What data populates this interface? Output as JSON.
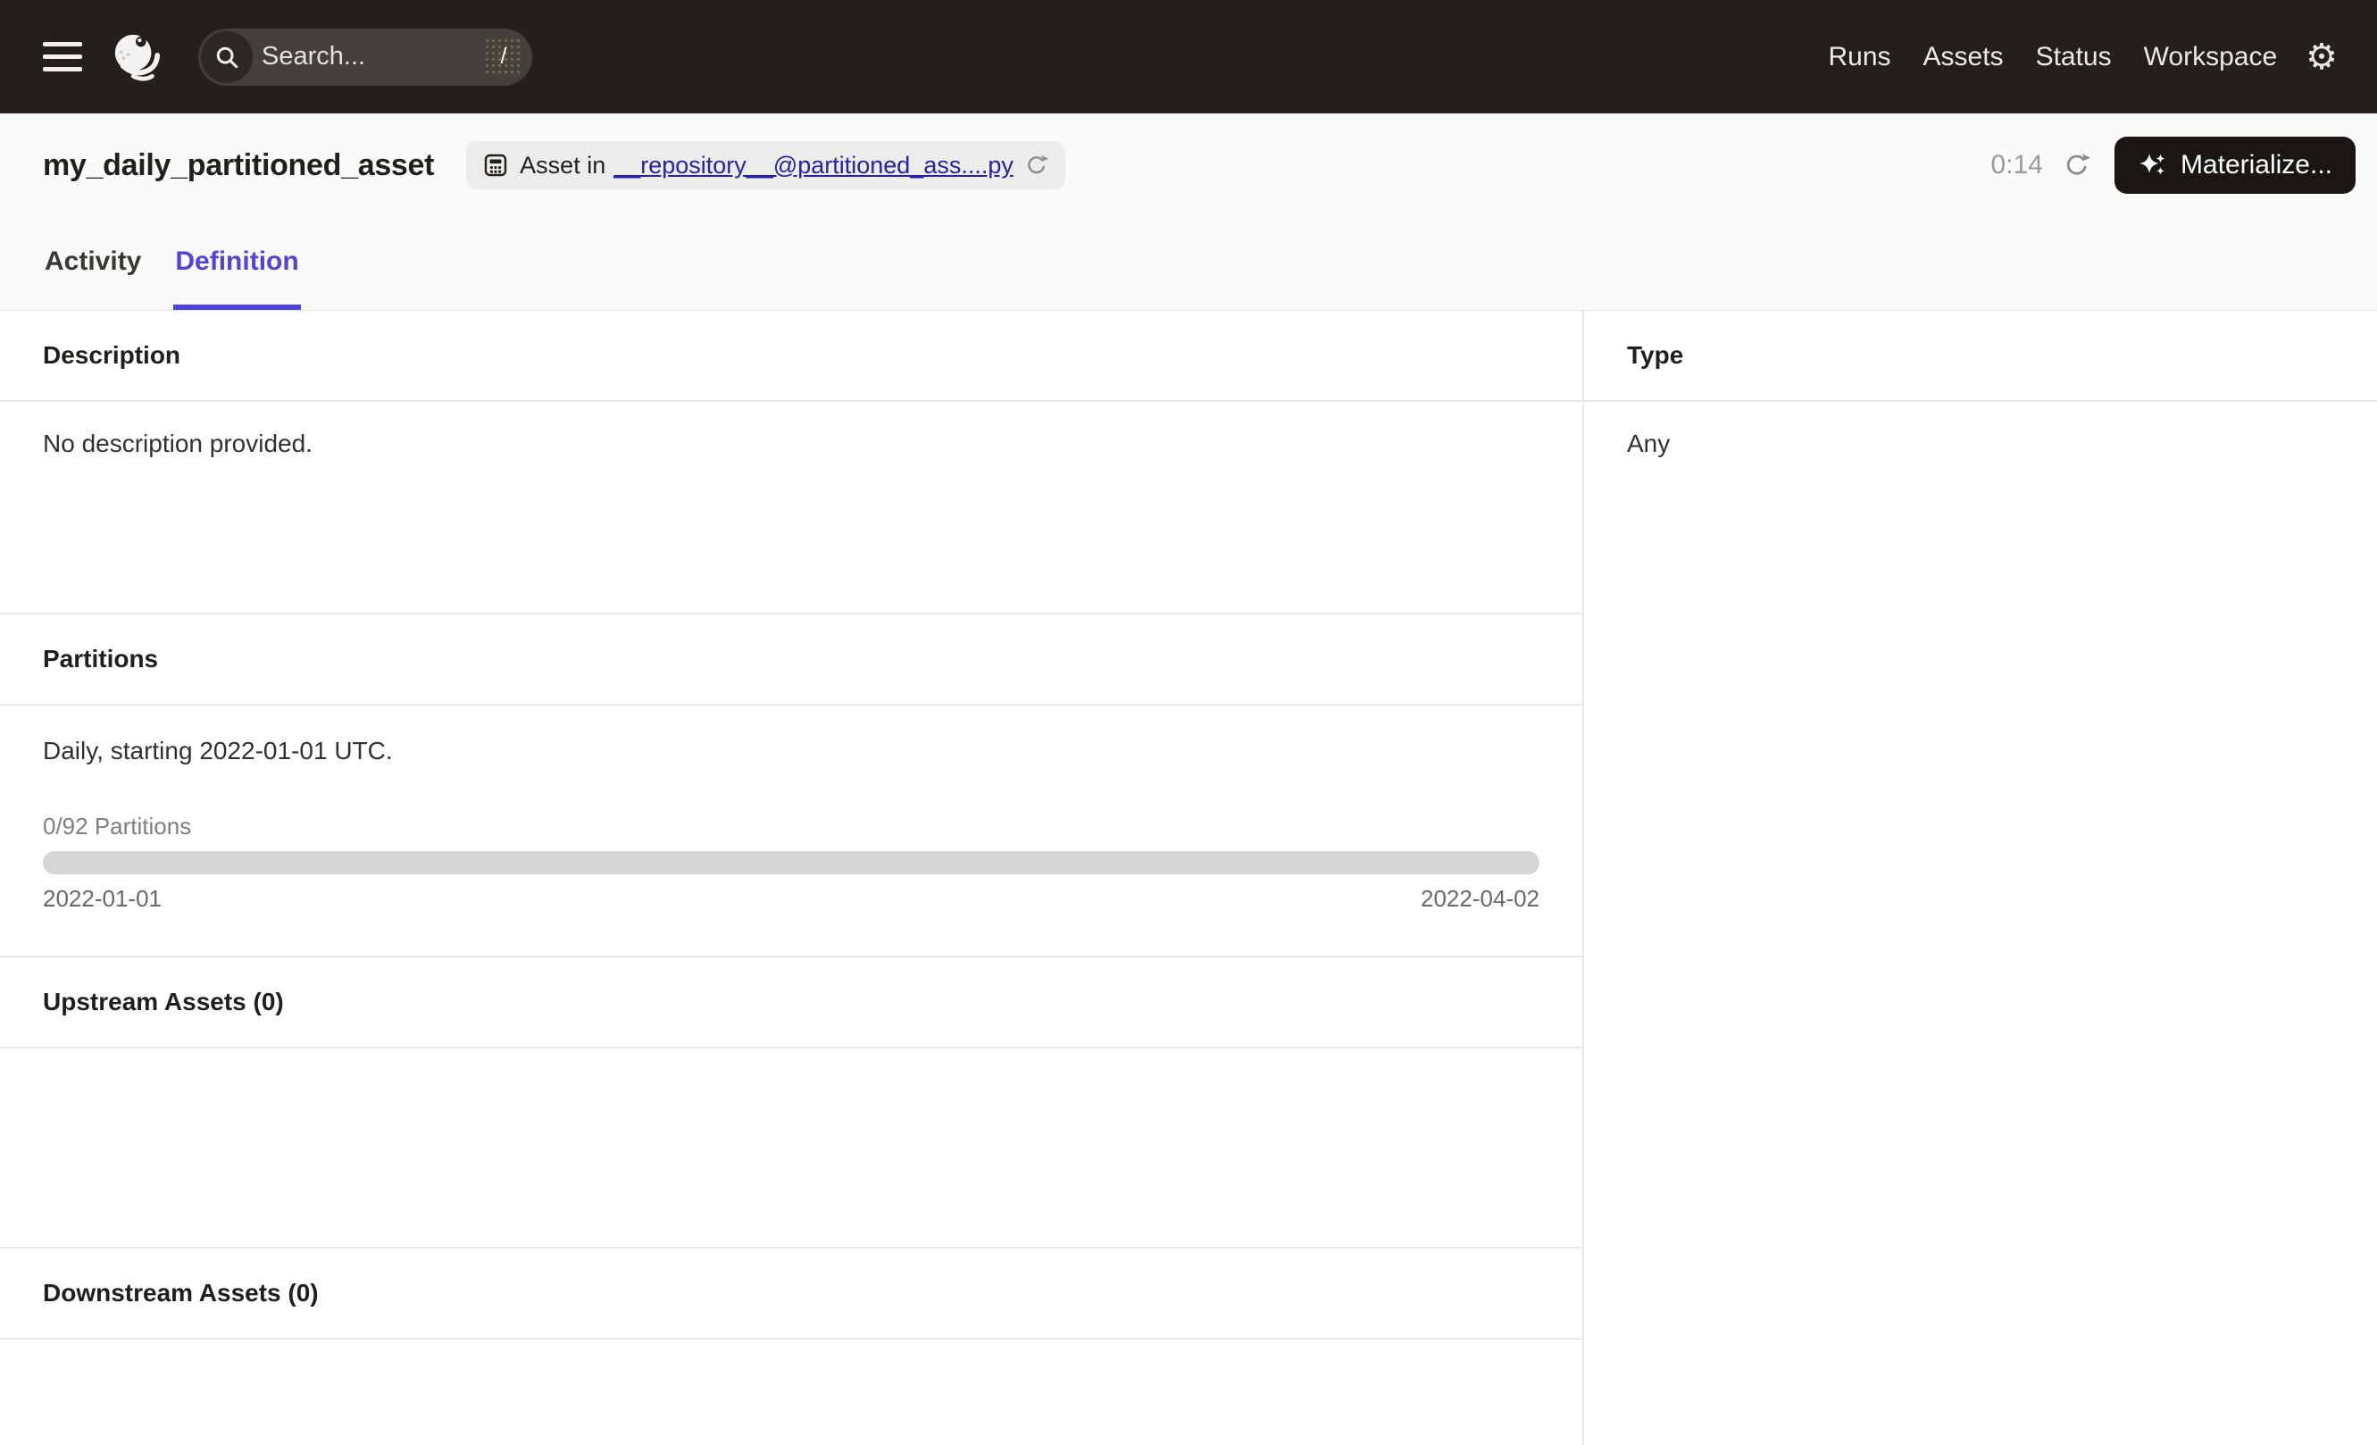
{
  "topnav": {
    "search": {
      "placeholder": "Search...",
      "shortcut_key": "/"
    },
    "links": [
      "Runs",
      "Assets",
      "Status",
      "Workspace"
    ]
  },
  "icons": {
    "gear_glyph": "⚙"
  },
  "header": {
    "title": "my_daily_partitioned_asset",
    "asset_tag": {
      "prefix": "Asset in",
      "link_text": "__repository__@partitioned_ass....py"
    },
    "refresh_countdown": "0:14",
    "materialize_label": "Materialize..."
  },
  "tabs": [
    {
      "label": "Activity",
      "active": false
    },
    {
      "label": "Definition",
      "active": true
    }
  ],
  "main": {
    "description": {
      "heading": "Description",
      "body": "No description provided."
    },
    "partitions": {
      "heading": "Partitions",
      "summary": "Daily, starting 2022-01-01 UTC.",
      "progress_label": "0/92 Partitions",
      "progress_percent": 0,
      "range_start": "2022-01-01",
      "range_end": "2022-04-02"
    },
    "upstream": {
      "heading": "Upstream Assets (0)"
    },
    "downstream": {
      "heading": "Downstream Assets (0)"
    },
    "type_panel": {
      "heading": "Type",
      "value": "Any"
    }
  },
  "colors": {
    "accent": "#4F43DD",
    "link": "#2522A8",
    "topnav_bg": "#231F1D",
    "header_bg": "#FAFAF9",
    "materialize_bg": "#191613",
    "progress_track": "#D7D5D3",
    "divider": "#E9E8E6"
  }
}
